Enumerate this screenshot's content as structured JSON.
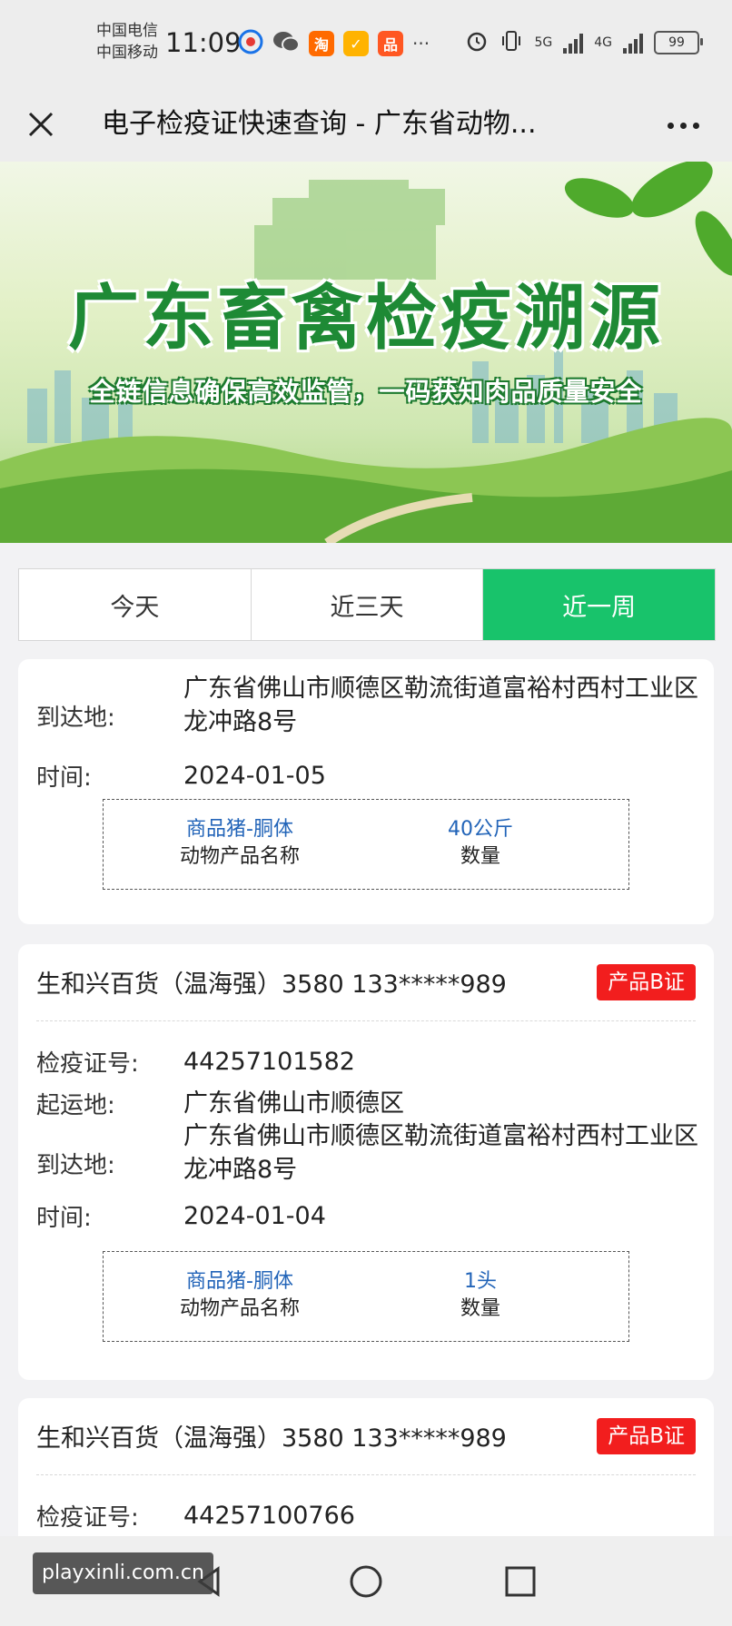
{
  "status_bar": {
    "carrier1": "中国电信",
    "carrier2": "中国移动",
    "time": "11:09",
    "net1": "5G",
    "net2": "4G",
    "battery": "99"
  },
  "title_bar": {
    "title": "电子检疫证快速查询 - 广东省动物..."
  },
  "banner": {
    "title": "广东畜禽检疫溯源",
    "subtitle": "全链信息确保高效监管，一码获知肉品质量安全"
  },
  "tabs": [
    "今天",
    "近三天",
    "近一周"
  ],
  "active_tab": "近一周",
  "labels": {
    "cert_no": "检疫证号:",
    "origin": "起运地:",
    "destination": "到达地:",
    "time": "时间:",
    "product_name": "动物产品名称",
    "quantity": "数量"
  },
  "cards": [
    {
      "destination": "广东省佛山市顺德区勒流街道富裕村西村工业区龙冲路8号",
      "time": "2024-01-05",
      "product": "商品猪-胴体",
      "qty": "40公斤"
    },
    {
      "shop": "生和兴百货（温海强）3580 133*****989",
      "badge": "产品B证",
      "cert_no": "44257101582",
      "origin": "广东省佛山市顺德区",
      "destination": "广东省佛山市顺德区勒流街道富裕村西村工业区龙冲路8号",
      "time": "2024-01-04",
      "product": "商品猪-胴体",
      "qty": "1头"
    },
    {
      "shop": "生和兴百货（温海强）3580 133*****989",
      "badge": "产品B证",
      "cert_no": "44257100766"
    }
  ],
  "watermark": "playxinli.com.cn",
  "colors": {
    "active_tab": "#18c36b",
    "badge": "#f21e1e",
    "product_value": "#2264b8"
  }
}
